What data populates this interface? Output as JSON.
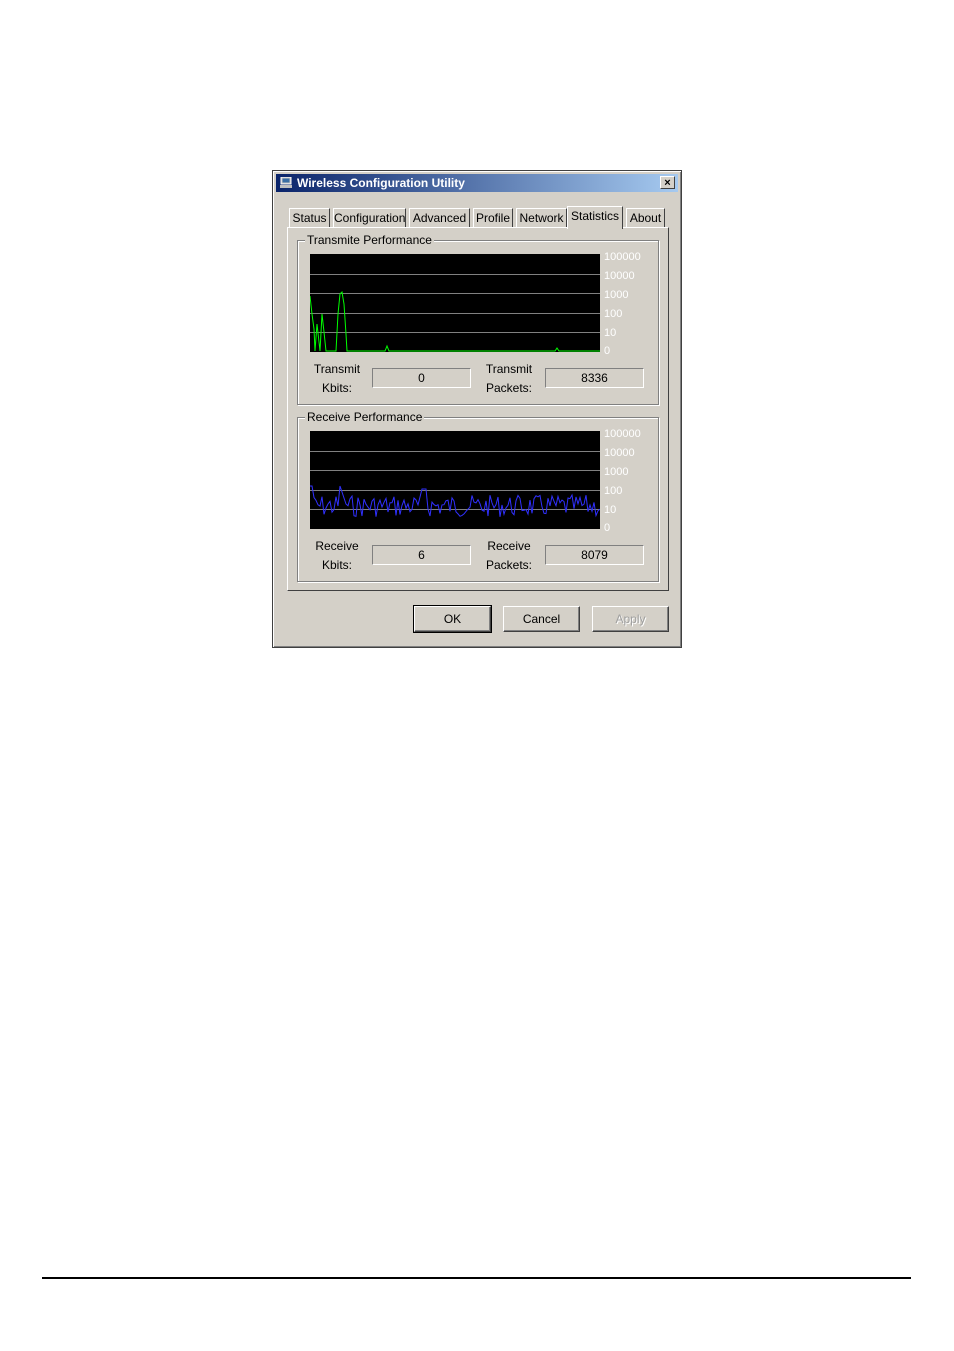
{
  "window": {
    "title": "Wireless Configuration Utility",
    "close_label": "×"
  },
  "tabs": [
    {
      "label": "Status"
    },
    {
      "label": "Configuration"
    },
    {
      "label": "Advanced"
    },
    {
      "label": "Profile"
    },
    {
      "label": "Network"
    },
    {
      "label": "Statistics",
      "active": true
    },
    {
      "label": "About"
    }
  ],
  "transmit": {
    "group_title": "Transmite Performance",
    "kbits_label_1": "Transmit",
    "kbits_label_2": "Kbits:",
    "kbits_value": "0",
    "packets_label_1": "Transmit",
    "packets_label_2": "Packets:",
    "packets_value": "8336",
    "line_color": "#00ff00"
  },
  "receive": {
    "group_title": "Receive Performance",
    "kbits_label_1": "Receive",
    "kbits_label_2": "Kbits:",
    "kbits_value": "6",
    "packets_label_1": "Receive",
    "packets_label_2": "Packets:",
    "packets_value": "8079",
    "line_color": "#3030ff"
  },
  "y_scale_labels": [
    "100000",
    "10000",
    "1000",
    "100",
    "10",
    "0"
  ],
  "buttons": {
    "ok": "OK",
    "cancel": "Cancel",
    "apply": "Apply"
  },
  "colors": {
    "window_bg": "#d4d0c8",
    "graph_bg": "#000000",
    "grid": "#808080",
    "titlebar_start": "#0a246a",
    "titlebar_end": "#a6caf0"
  }
}
